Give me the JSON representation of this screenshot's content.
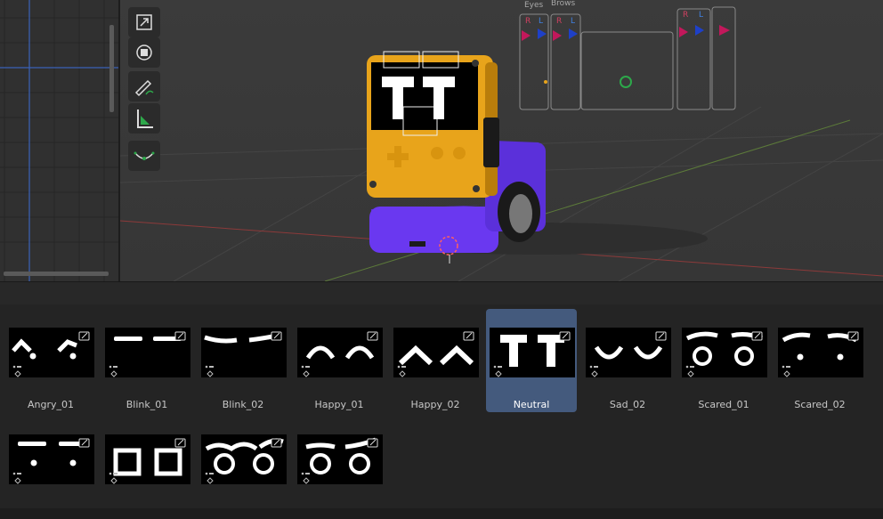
{
  "viewport": {
    "rig_labels": {
      "eyes": "Eyes",
      "brows": "Brows",
      "r": "R",
      "l": "L"
    },
    "tools": [
      {
        "name": "scale-tool",
        "icon": "scale-icon"
      },
      {
        "name": "transform-tool",
        "icon": "transform-icon"
      },
      {
        "name": "annotate-tool",
        "icon": "annotate-pencil-icon"
      },
      {
        "name": "measure-tool",
        "icon": "measure-ruler-icon"
      },
      {
        "name": "curve-tool",
        "icon": "curve-icon"
      }
    ],
    "colors": {
      "robot_body": "#e8a41b",
      "robot_base": "#6a38f0",
      "rig_red": "#c2185b",
      "rig_blue": "#1e40c8"
    }
  },
  "pose_library": {
    "selected": "Neutral",
    "assets": [
      {
        "label": "Angry_01",
        "shape": "angry"
      },
      {
        "label": "Blink_01",
        "shape": "blink1"
      },
      {
        "label": "Blink_02",
        "shape": "blink2"
      },
      {
        "label": "Happy_01",
        "shape": "happy1"
      },
      {
        "label": "Happy_02",
        "shape": "happy2"
      },
      {
        "label": "Neutral",
        "shape": "neutral"
      },
      {
        "label": "Sad_02",
        "shape": "sad"
      },
      {
        "label": "Scared_01",
        "shape": "scared1"
      },
      {
        "label": "Scared_02",
        "shape": "scared2"
      },
      {
        "label": "",
        "shape": "dots"
      },
      {
        "label": "",
        "shape": "squares"
      },
      {
        "label": "",
        "shape": "rings"
      },
      {
        "label": "",
        "shape": "rings2"
      }
    ]
  }
}
